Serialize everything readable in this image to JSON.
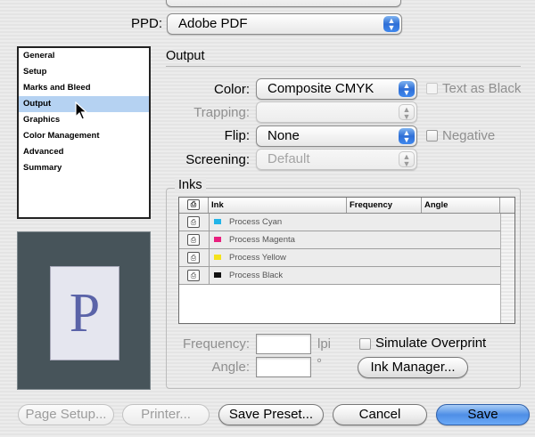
{
  "colors": {
    "accent": "#3f88ee",
    "selection": "#b5d2f2",
    "preview_bg": "#47545a",
    "page_letter": "#5a63a8"
  },
  "ppd": {
    "label": "PPD:",
    "value": "Adobe PDF"
  },
  "sidebar": {
    "items": [
      {
        "label": "General"
      },
      {
        "label": "Setup"
      },
      {
        "label": "Marks and Bleed"
      },
      {
        "label": "Output",
        "selected": true
      },
      {
        "label": "Graphics"
      },
      {
        "label": "Color Management"
      },
      {
        "label": "Advanced"
      },
      {
        "label": "Summary"
      }
    ]
  },
  "preview": {
    "letter": "P"
  },
  "output": {
    "title": "Output",
    "color_label": "Color:",
    "color_value": "Composite CMYK",
    "text_as_black_label": "Text as Black",
    "trapping_label": "Trapping:",
    "trapping_value": "",
    "flip_label": "Flip:",
    "flip_value": "None",
    "negative_label": "Negative",
    "screening_label": "Screening:",
    "screening_value": "Default"
  },
  "inks": {
    "title": "Inks",
    "columns": [
      "Ink",
      "Frequency",
      "Angle"
    ],
    "rows": [
      {
        "name": "Process Cyan",
        "swatch": "#22b4e8"
      },
      {
        "name": "Process Magenta",
        "swatch": "#e8207e"
      },
      {
        "name": "Process Yellow",
        "swatch": "#f4e21c"
      },
      {
        "name": "Process Black",
        "swatch": "#111111"
      }
    ],
    "frequency_label": "Frequency:",
    "frequency_value": "",
    "frequency_unit": "lpi",
    "angle_label": "Angle:",
    "angle_value": "",
    "angle_unit": "°",
    "simulate_overprint_label": "Simulate Overprint",
    "ink_manager_label": "Ink Manager..."
  },
  "buttons": {
    "page_setup": "Page Setup...",
    "printer": "Printer...",
    "save_preset": "Save Preset...",
    "cancel": "Cancel",
    "save": "Save"
  }
}
